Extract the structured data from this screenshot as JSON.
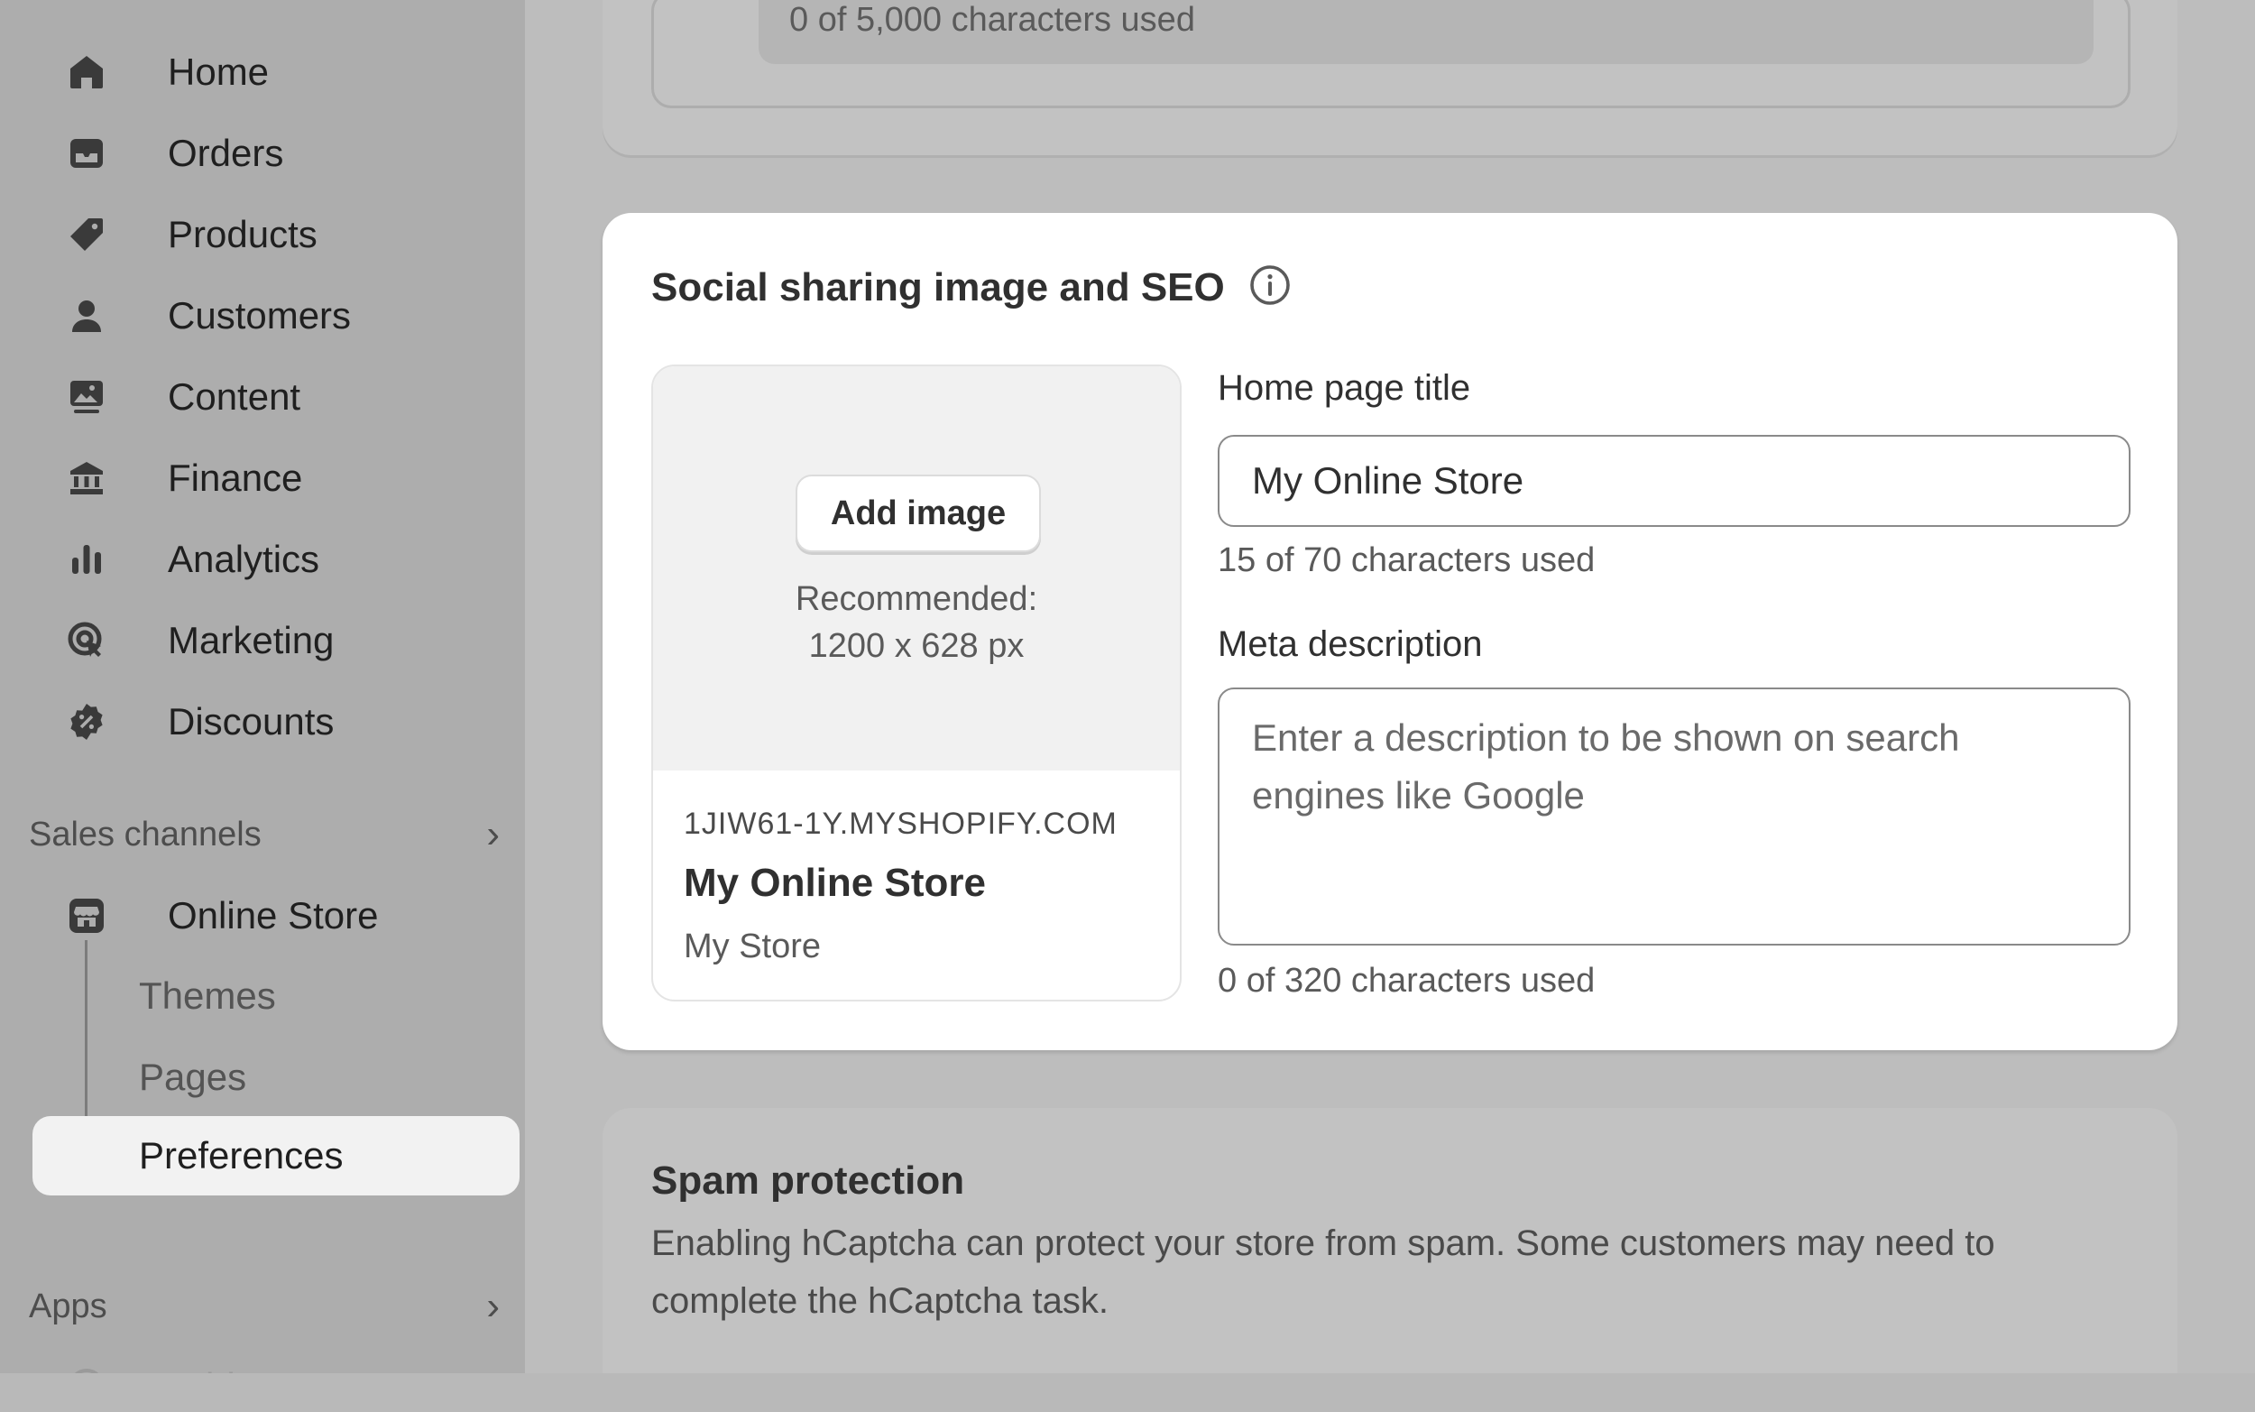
{
  "sidebar": {
    "items": [
      {
        "label": "Home",
        "icon": "home-icon"
      },
      {
        "label": "Orders",
        "icon": "inbox-icon"
      },
      {
        "label": "Products",
        "icon": "tag-icon"
      },
      {
        "label": "Customers",
        "icon": "person-icon"
      },
      {
        "label": "Content",
        "icon": "image-icon"
      },
      {
        "label": "Finance",
        "icon": "bank-icon"
      },
      {
        "label": "Analytics",
        "icon": "bar-chart-icon"
      },
      {
        "label": "Marketing",
        "icon": "target-icon"
      },
      {
        "label": "Discounts",
        "icon": "discount-icon"
      }
    ],
    "sales_channels_label": "Sales channels",
    "online_store_label": "Online Store",
    "sub_items": [
      "Themes",
      "Pages",
      "Preferences"
    ],
    "apps_label": "Apps",
    "add_apps_label": "Add apps"
  },
  "top_card": {
    "counter": "0 of 5,000 characters used"
  },
  "seo": {
    "title": "Social sharing image and SEO",
    "add_image_label": "Add image",
    "recommended_line1": "Recommended:",
    "recommended_line2": "1200 x 628 px",
    "preview_domain": "1JIW61-1Y.MYSHOPIFY.COM",
    "preview_title": "My Online Store",
    "preview_description": "My Store",
    "home_title_label": "Home page title",
    "home_title_value": "My Online Store",
    "home_title_counter": "15 of 70 characters used",
    "meta_label": "Meta description",
    "meta_placeholder": "Enter a description to be shown on search engines like Google",
    "meta_counter": "0 of 320 characters used"
  },
  "spam": {
    "title": "Spam protection",
    "description": "Enabling hCaptcha can protect your store from spam. Some customers may need to complete the hCaptcha task."
  },
  "colors": {
    "overlay_bg": "#bdbdbd",
    "card_bg": "#ffffff",
    "text": "#303030"
  }
}
